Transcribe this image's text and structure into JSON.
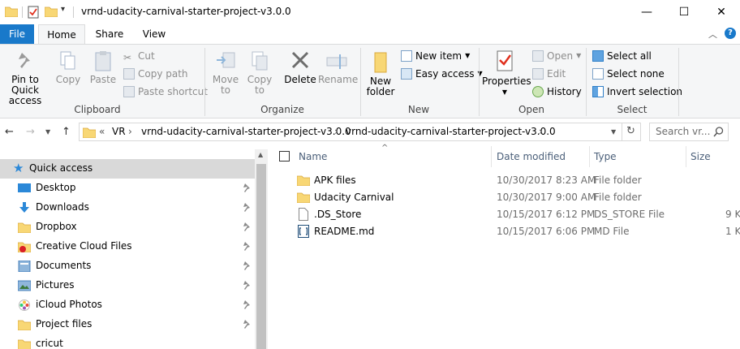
{
  "window": {
    "title": "vrnd-udacity-carnival-starter-project-v3.0.0",
    "controls": {
      "minimize": "—",
      "maximize": "☐",
      "close": "✕"
    }
  },
  "ribbon_tabs": {
    "file": "File",
    "home": "Home",
    "share": "Share",
    "view": "View"
  },
  "ribbon": {
    "clipboard": {
      "pin_to_quick_access": [
        "Pin to Quick",
        "access"
      ],
      "copy": "Copy",
      "paste": "Paste",
      "cut": "Cut",
      "copy_path": "Copy path",
      "paste_shortcut": "Paste shortcut",
      "label": "Clipboard"
    },
    "organize": {
      "move_to": [
        "Move",
        "to"
      ],
      "copy_to": [
        "Copy",
        "to"
      ],
      "delete": "Delete",
      "rename": "Rename",
      "label": "Organize"
    },
    "new": {
      "new_folder": [
        "New",
        "folder"
      ],
      "new_item": "New item",
      "easy_access": "Easy access",
      "label": "New"
    },
    "open": {
      "properties": "Properties",
      "open": "Open",
      "edit": "Edit",
      "history": "History",
      "label": "Open"
    },
    "select": {
      "select_all": "Select all",
      "select_none": "Select none",
      "invert_selection": "Invert selection",
      "label": "Select"
    }
  },
  "address": {
    "prefix": "«",
    "crumbs": [
      "VR",
      "vrnd-udacity-carnival-starter-project-v3.0.0",
      "vrnd-udacity-carnival-starter-project-v3.0.0"
    ],
    "search_placeholder": "Search vr..."
  },
  "nav_pane": {
    "quick_access": "Quick access",
    "items": [
      {
        "label": "Desktop",
        "icon": "desktop-icon",
        "pinned": true
      },
      {
        "label": "Downloads",
        "icon": "download-icon",
        "pinned": true
      },
      {
        "label": "Dropbox",
        "icon": "folder-icon",
        "pinned": true
      },
      {
        "label": "Creative Cloud Files",
        "icon": "creative-cloud-icon",
        "pinned": true
      },
      {
        "label": "Documents",
        "icon": "documents-icon",
        "pinned": true
      },
      {
        "label": "Pictures",
        "icon": "pictures-icon",
        "pinned": true
      },
      {
        "label": "iCloud Photos",
        "icon": "icloud-photos-icon",
        "pinned": true
      },
      {
        "label": "Project files",
        "icon": "folder-icon",
        "pinned": true
      },
      {
        "label": "cricut",
        "icon": "folder-icon",
        "pinned": false
      }
    ]
  },
  "file_list": {
    "columns": {
      "name": "Name",
      "date": "Date modified",
      "type": "Type",
      "size": "Size"
    },
    "rows": [
      {
        "name": "APK files",
        "date": "10/30/2017 8:23 AM",
        "type": "File folder",
        "size": "",
        "icon": "folder-icon"
      },
      {
        "name": "Udacity Carnival",
        "date": "10/30/2017 9:00 AM",
        "type": "File folder",
        "size": "",
        "icon": "folder-icon"
      },
      {
        "name": ".DS_Store",
        "date": "10/15/2017 6:12 PM",
        "type": "DS_STORE File",
        "size": "9 K",
        "icon": "blank-file-icon"
      },
      {
        "name": "README.md",
        "date": "10/15/2017 6:06 PM",
        "type": "MD File",
        "size": "1 K",
        "icon": "markdown-file-icon"
      }
    ]
  },
  "colors": {
    "accent": "#1979ca",
    "ribbon_bg": "#f5f6f7",
    "folder": "#f8d775",
    "selected": "#d9d9d9"
  }
}
